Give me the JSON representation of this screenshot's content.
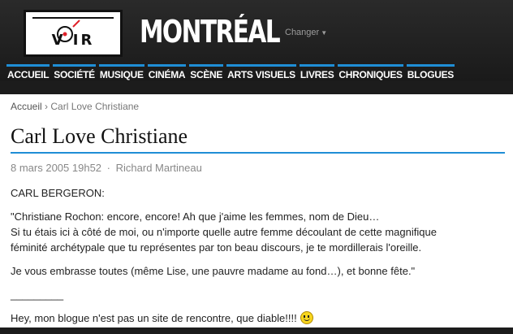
{
  "header": {
    "logo_text": "V  IR",
    "logo_full": "VOIR",
    "city": "MONTRÉAL",
    "changer": "Changer"
  },
  "nav": [
    {
      "label": "ACCUEIL"
    },
    {
      "label": "SOCIÉTÉ"
    },
    {
      "label": "MUSIQUE"
    },
    {
      "label": "CINÉMA"
    },
    {
      "label": "SCÈNE"
    },
    {
      "label": "ARTS VISUELS"
    },
    {
      "label": "LIVRES"
    },
    {
      "label": "CHRONIQUES"
    },
    {
      "label": "BLOGUES"
    }
  ],
  "breadcrumb": {
    "home": "Accueil",
    "separator": "›",
    "current": "Carl Love Christiane"
  },
  "article": {
    "title": "Carl Love Christiane",
    "date": "8 mars 2005 19h52",
    "separator": "·",
    "author": "Richard Martineau",
    "p1": "CARL BERGERON:",
    "p2_line1": "\"Christiane Rochon: encore, encore! Ah que j'aime les femmes, nom de Dieu…",
    "p2_line2": "Si tu étais ici à côté de moi, ou n'importe quelle autre femme découlant de cette magnifique",
    "p2_line3": "féminité archétypale que tu représentes par ton beau discours, je te mordillerais l'oreille.",
    "p3": "Je vous embrasse toutes (même Lise, une pauvre madame au fond…), et bonne fête.\"",
    "divider": "_________",
    "p4": "Hey, mon blogue n'est pas un site de rencontre, que diable!!!!"
  },
  "colors": {
    "accent": "#1f8ed6",
    "header_bg": "#1c1c1c",
    "logo_mark": "#e0222a"
  },
  "icons": {
    "smiley": "smiley-icon",
    "dropdown": "chevron-down-icon"
  }
}
